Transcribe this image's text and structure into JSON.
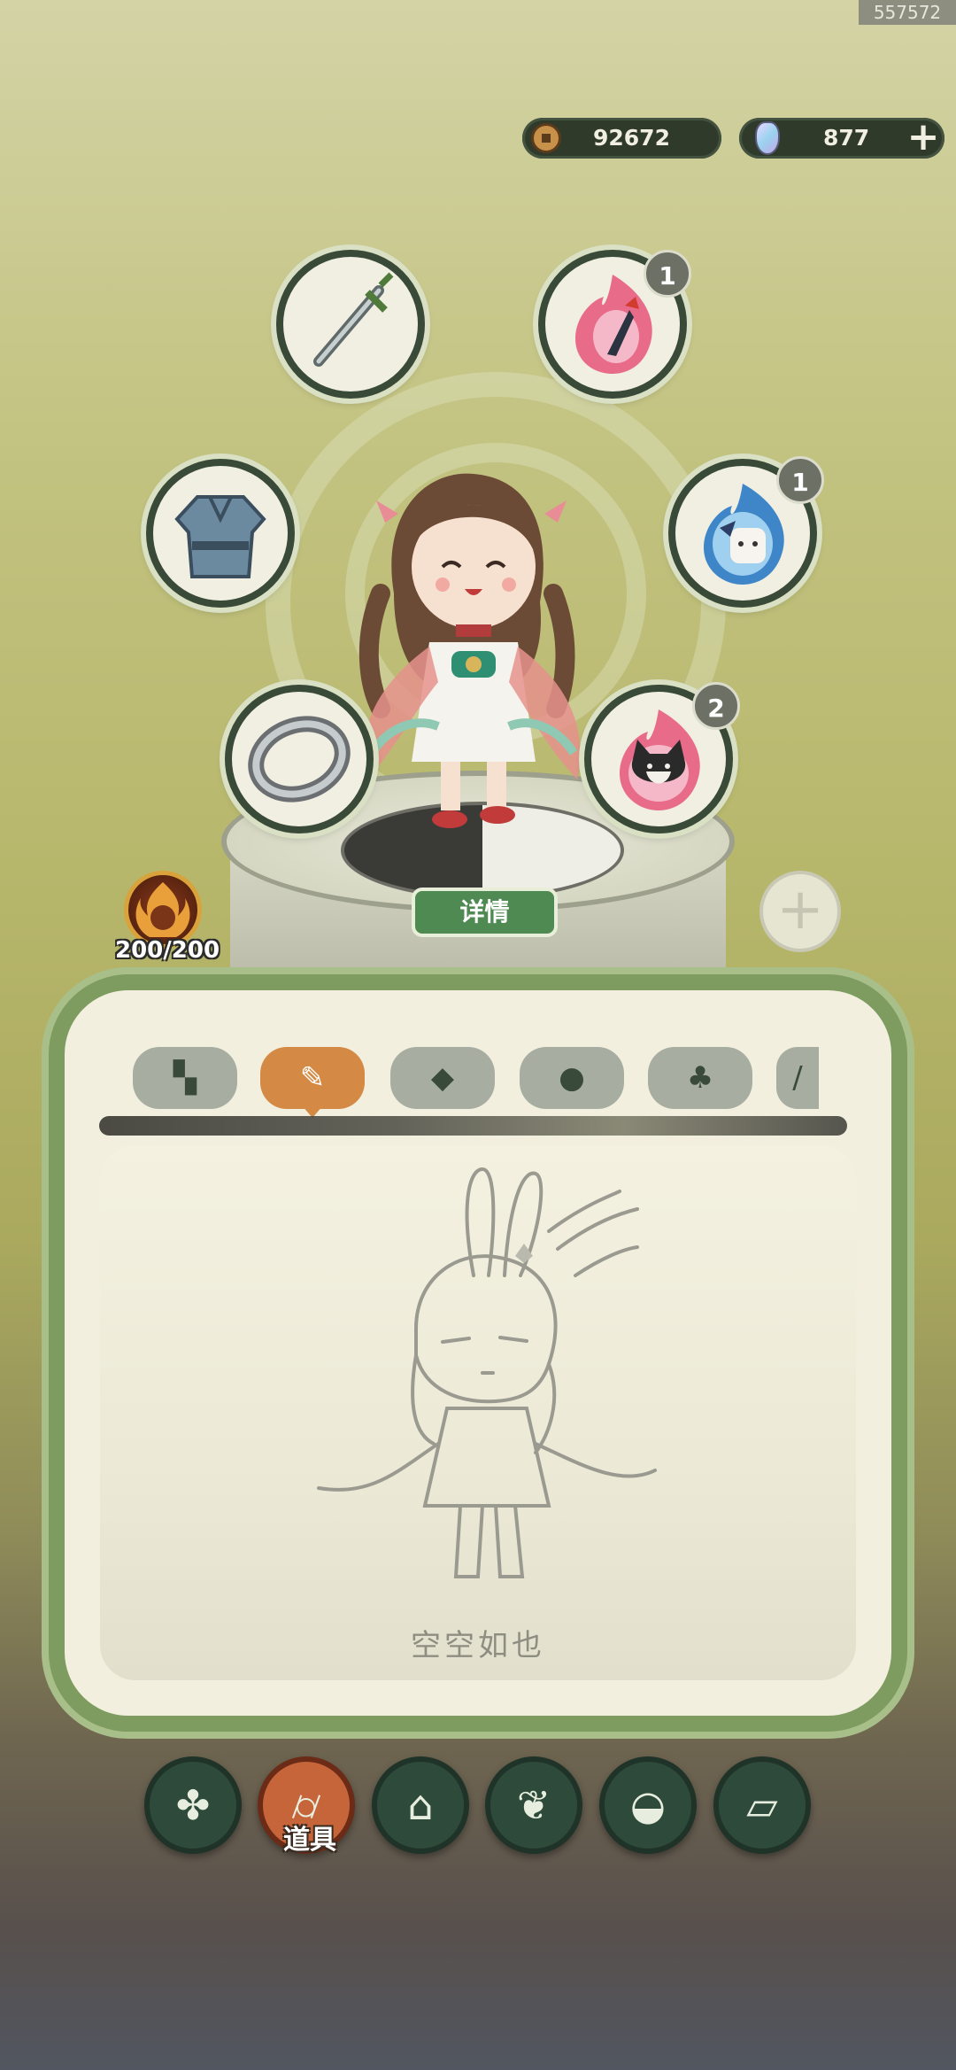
{
  "watermark": "557572",
  "currency": {
    "coins": "92672",
    "gems": "877",
    "coin_icon": "copper-coin-icon",
    "gem_icon": "crystal-gem-icon",
    "add_icon": "plus-icon"
  },
  "equipment": {
    "weapon_icon": "sword-icon",
    "armor_icon": "armor-icon",
    "accessory_icon": "ring-icon",
    "spirit_slots": [
      {
        "icon": "phoenix-spirit-icon",
        "count": "1"
      },
      {
        "icon": "fox-spirit-icon",
        "count": "1"
      },
      {
        "icon": "cat-spirit-icon",
        "count": "2"
      }
    ]
  },
  "character": {
    "details_label": "详情",
    "hp": "200/200",
    "avatar_icon": "flame-avatar-icon"
  },
  "inventory": {
    "tabs": [
      {
        "icon": "grid-icon",
        "active": false
      },
      {
        "icon": "scroll-icon",
        "active": true
      },
      {
        "icon": "ore-icon",
        "active": false
      },
      {
        "icon": "pill-icon",
        "active": false
      },
      {
        "icon": "sprout-icon",
        "active": false
      },
      {
        "icon": "more-icon",
        "active": false
      }
    ],
    "empty_text": "空空如也"
  },
  "bottom_nav": [
    {
      "icon": "grid-icon",
      "label": ""
    },
    {
      "icon": "log-icon",
      "label": "道具",
      "active": true
    },
    {
      "icon": "house-icon",
      "label": ""
    },
    {
      "icon": "herb-icon",
      "label": ""
    },
    {
      "icon": "bowl-icon",
      "label": ""
    },
    {
      "icon": "map-scroll-icon",
      "label": ""
    }
  ],
  "colors": {
    "accent_active": "#d48a44",
    "panel_border": "#7e9b60",
    "details_button": "#4e8a52"
  }
}
